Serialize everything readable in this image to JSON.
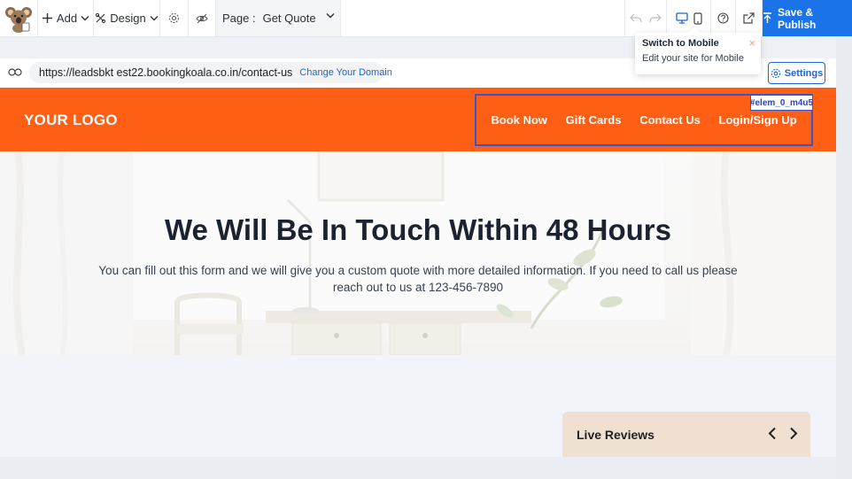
{
  "toolbar": {
    "add_label": "Add",
    "design_label": "Design",
    "page_prefix": "Page :",
    "page_value": "Get Quote",
    "publish_label": "Save & Publish"
  },
  "urlbar": {
    "url": "https://leadsbkt est22.bookingkoala.co.in/contact-us",
    "change_domain": "Change Your Domain",
    "settings_label": "Settings"
  },
  "tooltip": {
    "title": "Switch to Mobile",
    "subtitle": "Edit your site for Mobile",
    "close": "×"
  },
  "site_header": {
    "logo": "YOUR LOGO",
    "nav": [
      "Book Now",
      "Gift Cards",
      "Contact Us",
      "Login/Sign Up"
    ],
    "selected_element_id": "#elem_0_m4u5"
  },
  "hero": {
    "title": "We Will Be In Touch Within 48 Hours",
    "subtitle": "You can fill out this form and we will give you a custom quote with more detailed information. If you need to call us please reach out to us at 123-456-7890"
  },
  "reviews": {
    "title": "Live Reviews"
  },
  "colors": {
    "brand_orange": "#ff5f14",
    "accent_blue": "#1a73e8",
    "selection_blue": "#3a55c8"
  },
  "icons": [
    "koala-logo-icon",
    "plus-icon",
    "palette-icon",
    "gear-icon",
    "eye-slash-icon",
    "undo-icon",
    "redo-icon",
    "desktop-icon",
    "mobile-icon",
    "help-icon",
    "external-link-icon",
    "publish-icon",
    "link-icon",
    "chevron-left-icon",
    "chevron-right-icon"
  ]
}
